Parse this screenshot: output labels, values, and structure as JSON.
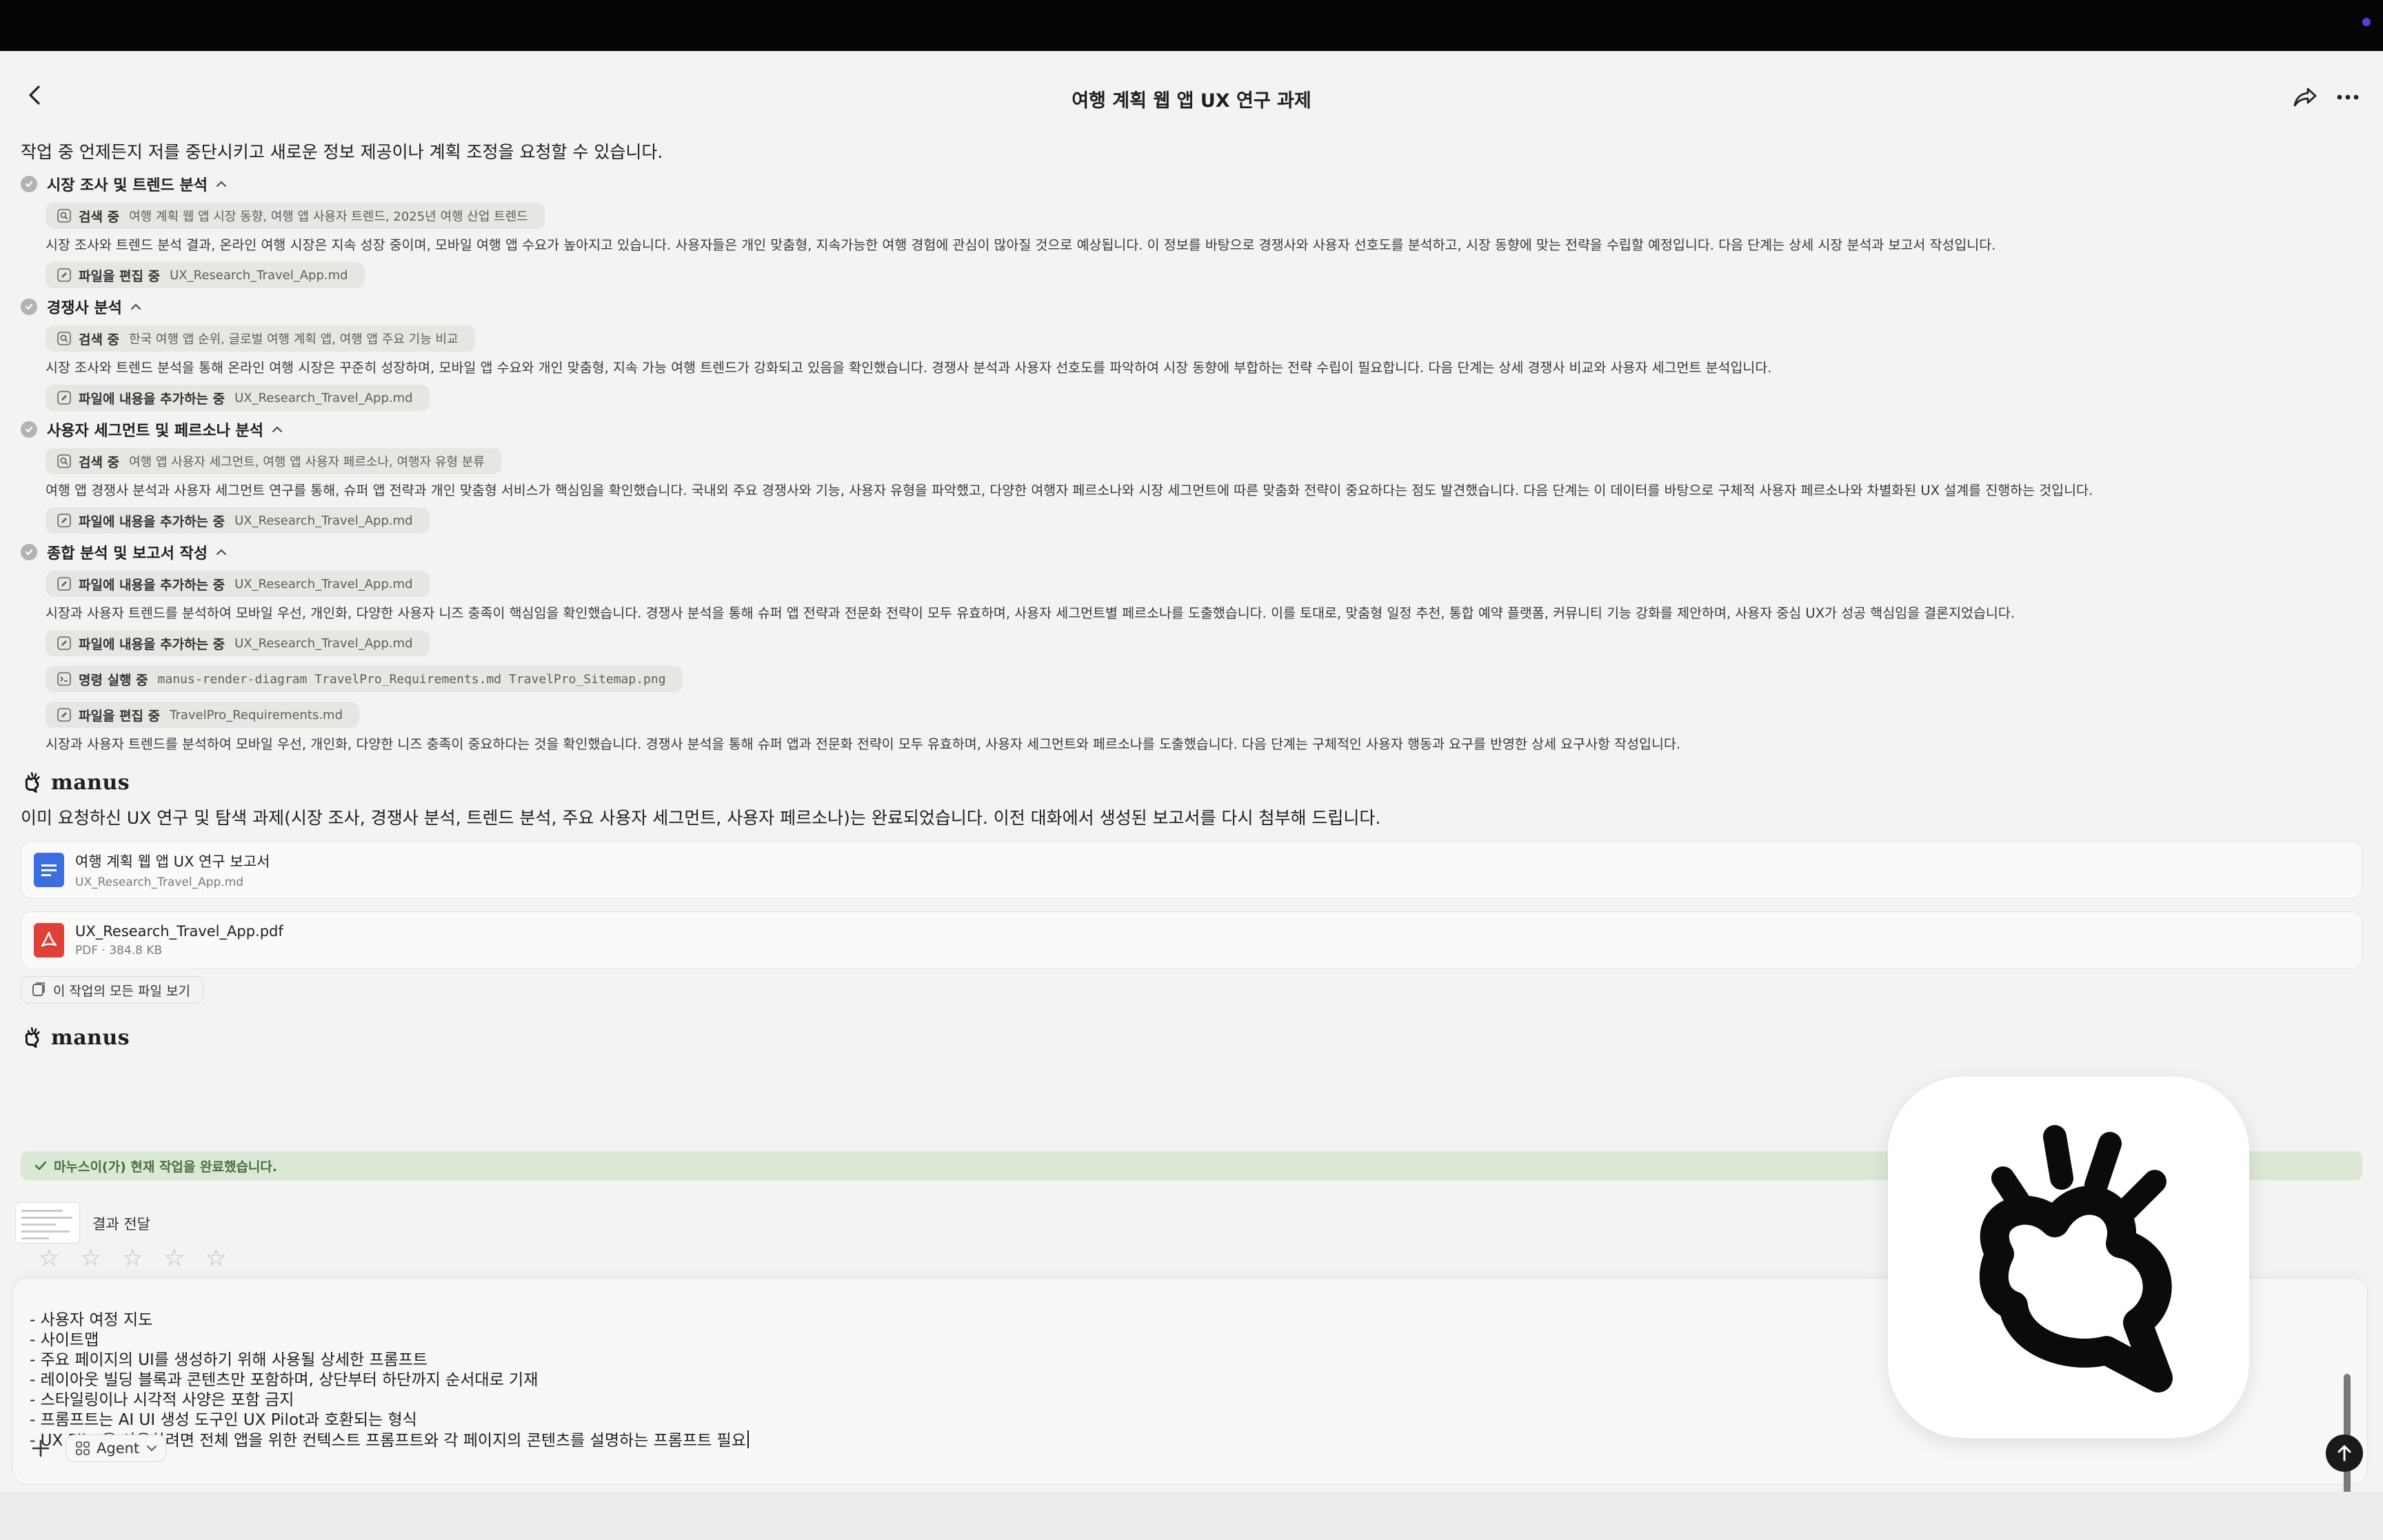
{
  "window": {
    "title": "여행 계획 웹 앱 UX 연구 과제"
  },
  "intro": "작업 중 언제든지 저를 중단시키고 새로운 정보 제공이나 계획 조정을 요청할 수 있습니다.",
  "steps": [
    {
      "title": "시장 조사 및 트렌드 분석",
      "actions": [
        {
          "verb": "검색 중",
          "arg": "여행 계획 웹 앱 시장 동향, 여행 앱 사용자 트렌드, 2025년 여행 산업 트렌드"
        }
      ],
      "desc": "시장 조사와 트렌드 분석 결과, 온라인 여행 시장은 지속 성장 중이며, 모바일 여행 앱 수요가 높아지고 있습니다. 사용자들은 개인 맞춤형, 지속가능한 여행 경험에 관심이 많아질 것으로 예상됩니다. 이 정보를 바탕으로 경쟁사와 사용자 선호도를 분석하고, 시장 동향에 맞는 전략을 수립할 예정입니다. 다음 단계는 상세 시장 분석과 보고서 작성입니다.",
      "after": [
        {
          "verb": "파일을 편집 중",
          "arg": "UX_Research_Travel_App.md"
        }
      ]
    },
    {
      "title": "경쟁사 분석",
      "actions": [
        {
          "verb": "검색 중",
          "arg": "한국 여행 앱 순위, 글로벌 여행 계획 앱, 여행 앱 주요 기능 비교"
        }
      ],
      "desc": "시장 조사와 트렌드 분석을 통해 온라인 여행 시장은 꾸준히 성장하며, 모바일 앱 수요와 개인 맞춤형, 지속 가능 여행 트렌드가 강화되고 있음을 확인했습니다. 경쟁사 분석과 사용자 선호도를 파악하여 시장 동향에 부합하는 전략 수립이 필요합니다. 다음 단계는 상세 경쟁사 비교와 사용자 세그먼트 분석입니다.",
      "after": [
        {
          "verb": "파일에 내용을 추가하는 중",
          "arg": "UX_Research_Travel_App.md"
        }
      ]
    },
    {
      "title": "사용자 세그먼트 및 페르소나 분석",
      "actions": [
        {
          "verb": "검색 중",
          "arg": "여행 앱 사용자 세그먼트, 여행 앱 사용자 페르소나, 여행자 유형 분류"
        }
      ],
      "desc": "여행 앱 경쟁사 분석과 사용자 세그먼트 연구를 통해, 슈퍼 앱 전략과 개인 맞춤형 서비스가 핵심임을 확인했습니다. 국내외 주요 경쟁사와 기능, 사용자 유형을 파악했고, 다양한 여행자 페르소나와 시장 세그먼트에 따른 맞춤화 전략이 중요하다는 점도 발견했습니다. 다음 단계는 이 데이터를 바탕으로 구체적 사용자 페르소나와 차별화된 UX 설계를 진행하는 것입니다.",
      "after": [
        {
          "verb": "파일에 내용을 추가하는 중",
          "arg": "UX_Research_Travel_App.md"
        }
      ]
    },
    {
      "title": "종합 분석 및 보고서 작성",
      "actions": [
        {
          "verb": "파일에 내용을 추가하는 중",
          "arg": "UX_Research_Travel_App.md"
        }
      ],
      "desc": "시장과 사용자 트렌드를 분석하여 모바일 우선, 개인화, 다양한 사용자 니즈 충족이 핵심임을 확인했습니다. 경쟁사 분석을 통해 슈퍼 앱 전략과 전문화 전략이 모두 유효하며, 사용자 세그먼트별 페르소나를 도출했습니다. 이를 토대로, 맞춤형 일정 추천, 통합 예약 플랫폼, 커뮤니티 기능 강화를 제안하며, 사용자 중심 UX가 성공 핵심임을 결론지었습니다.",
      "after": [
        {
          "verb": "파일에 내용을 추가하는 중",
          "arg": "UX_Research_Travel_App.md"
        },
        {
          "verb": "명령 실행 중",
          "arg": "manus-render-diagram TravelPro_Requirements.md TravelPro_Sitemap.png"
        },
        {
          "verb": "파일을 편집 중",
          "arg": "TravelPro_Requirements.md"
        }
      ],
      "desc2": "시장과 사용자 트렌드를 분석하여 모바일 우선, 개인화, 다양한 니즈 충족이 중요하다는 것을 확인했습니다. 경쟁사 분석을 통해 슈퍼 앱과 전문화 전략이 모두 유효하며, 사용자 세그먼트와 페르소나를 도출했습니다. 다음 단계는 구체적인 사용자 행동과 요구를 반영한 상세 요구사항 작성입니다."
    }
  ],
  "brand": "manus",
  "message": "이미 요청하신 UX 연구 및 탐색 과제(시장 조사, 경쟁사 분석, 트렌드 분석, 주요 사용자 세그먼트, 사용자 페르소나)는 완료되었습니다. 이전 대화에서 생성된 보고서를 다시 첨부해 드립니다.",
  "files": [
    {
      "name": "여행 계획 웹 앱 UX 연구 보고서",
      "meta": "UX_Research_Travel_App.md",
      "icon": "doc-icon",
      "color": "#3b6fe0"
    },
    {
      "name": "UX_Research_Travel_App.pdf",
      "meta": "PDF · 384.8 KB",
      "icon": "pdf-icon",
      "color": "#e0403a"
    }
  ],
  "all_files_label": "이 작업의 모든 파일 보기",
  "done_label": "마누스이(가) 현재 작업을 완료했습니다.",
  "result_label": "결과 전달",
  "rating": {
    "max": 5,
    "value": 0
  },
  "composer": {
    "lines": [
      "- 사용자 여정 지도",
      "- 사이트맵",
      "- 주요 페이지의 UI를 생성하기 위해 사용될 상세한 프롬프트",
      "- 레이아웃 빌딩 블록과 콘텐츠만 포함하며, 상단부터 하단까지 순서대로 기재",
      "- 스타일링이나 시각적 사양은 포함 금지",
      "- 프롬프트는 AI UI 생성 도구인 UX Pilot과 호환되는 형식",
      "- UX Pilot을 사용하려면 전체 앱을 위한 컨텍스트 프롬프트와 각 페이지의 콘텐츠를 설명하는 프롬프트 필요"
    ],
    "mode_label": "Agent"
  },
  "colors": {
    "accent": "#4b46d8",
    "done_bg": "#dce8d6",
    "done_text": "#4c6e43"
  }
}
